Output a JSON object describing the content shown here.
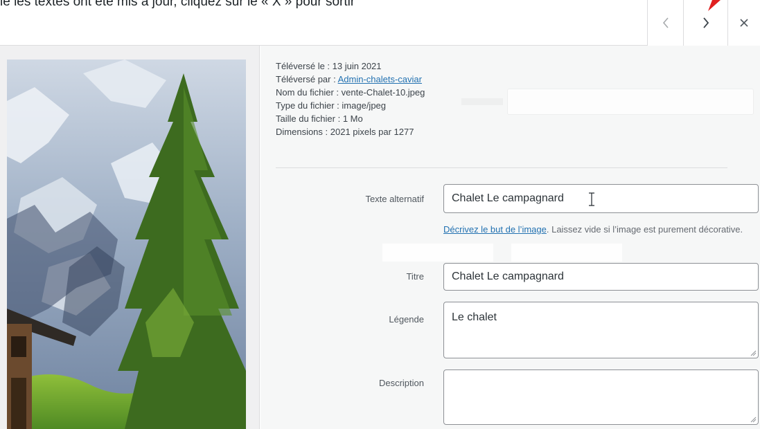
{
  "top": {
    "notice": "ie les textes ont été mis à jour, cliquez sur le « X » pour sortir"
  },
  "nav": {
    "prev_icon": "chevron-left-icon",
    "next_icon": "chevron-right-icon",
    "close_icon": "close-icon",
    "arrow_color": "#e02020"
  },
  "meta": {
    "uploaded_on_label": "Téléversé le :",
    "uploaded_on_value": "13 juin 2021",
    "uploaded_by_label": "Téléversé par :",
    "uploaded_by_value": "Admin-chalets-caviar",
    "file_name_label": "Nom du fichier :",
    "file_name_value": "vente-Chalet-10.jpeg",
    "file_type_label": "Type du fichier :",
    "file_type_value": "image/jpeg",
    "file_size_label": "Taille du fichier :",
    "file_size_value": "1 Mo",
    "dimensions_label": "Dimensions :",
    "dimensions_value": "2021 pixels par 1277"
  },
  "form": {
    "alt_label": "Texte alternatif",
    "alt_value": "Chalet Le campagnard",
    "help_link": "Décrivez le but de l’image",
    "help_text": ". Laissez vide si l’image est purement décorative.",
    "title_label": "Titre",
    "title_value": "Chalet Le campagnard",
    "caption_label": "Légende",
    "caption_value": "Le chalet",
    "description_label": "Description",
    "description_value": ""
  },
  "colors": {
    "link": "#2271b1",
    "border": "#8c8f94",
    "panel_bg": "#f6f7f7"
  }
}
